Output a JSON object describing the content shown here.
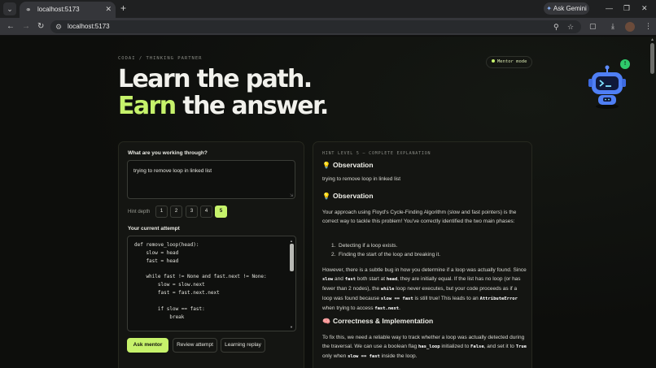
{
  "browser": {
    "tab_title": "localhost:5173",
    "url": "localhost:5173",
    "gemini_label": "Ask Gemini"
  },
  "hero": {
    "kicker": "CODAI / THINKING PARTNER",
    "mentor_mode": "Mentor mode",
    "line1": "Learn the path.",
    "line2_accent": "Earn",
    "line2_rest": " the answer.",
    "notification_count": "!"
  },
  "form": {
    "question_label": "What are you working through?",
    "question_value": "trying to remove  loop in linked list",
    "hint_depth_label": "Hint depth",
    "hint_depths": [
      "1",
      "2",
      "3",
      "4",
      "5"
    ],
    "selected_depth": "5",
    "attempt_label": "Your current attempt",
    "code_lines": [
      "def remove_loop(head):",
      "    slow = head",
      "    fast = head",
      "",
      "    while fast != None and fast.next != None:",
      "        slow = slow.next",
      "        fast = fast.next.next",
      "",
      "        if slow == fast:",
      "            break"
    ],
    "buttons": {
      "ask": "Ask mentor",
      "review": "Review attempt",
      "replay": "Learning replay"
    }
  },
  "explanation": {
    "hint_level": "HINT LEVEL 5 — COMPLETE EXPLANATION",
    "obs1_title": "Observation",
    "obs1_text": "trying to remove loop in linked list",
    "obs2_title": "Observation",
    "obs2_text": "Your approach using Floyd's Cycle-Finding Algorithm (slow and fast pointers) is the correct way to tackle this problem! You've correctly identified the two main phases:",
    "phases": [
      "Detecting if a loop exists.",
      "Finding the start of the loop and breaking it."
    ],
    "bug_p1": "However, there is a subtle bug in how you determine if a loop was actually found. Since ",
    "bug_c1": "slow",
    "bug_p2": " and ",
    "bug_c2": "fast",
    "bug_p3": " both start at ",
    "bug_c3": "head",
    "bug_p4": ", they are initially equal. If the list has no loop (or has fewer than 2 nodes), the ",
    "bug_c4": "while",
    "bug_p5": " loop never executes, but your code proceeds as if a loop was found because ",
    "bug_c5": "slow == fast",
    "bug_p6": " is still true! This leads to an ",
    "bug_c6": "AttributeError",
    "bug_p7": " when trying to access ",
    "bug_c7": "fast.next",
    "bug_p8": ".",
    "corr_title": "Correctness & Implementation",
    "fix_p1": "To fix this, we need a reliable way to track whether a loop was actually detected during the traversal. We can use a boolean flag ",
    "fix_c1": "has_loop",
    "fix_p2": " initialized to ",
    "fix_c2": "False",
    "fix_p3": ", and set it to ",
    "fix_c3": "True",
    "fix_p4": " only when ",
    "fix_c4": "slow == fast",
    "fix_p5": " inside the loop."
  }
}
